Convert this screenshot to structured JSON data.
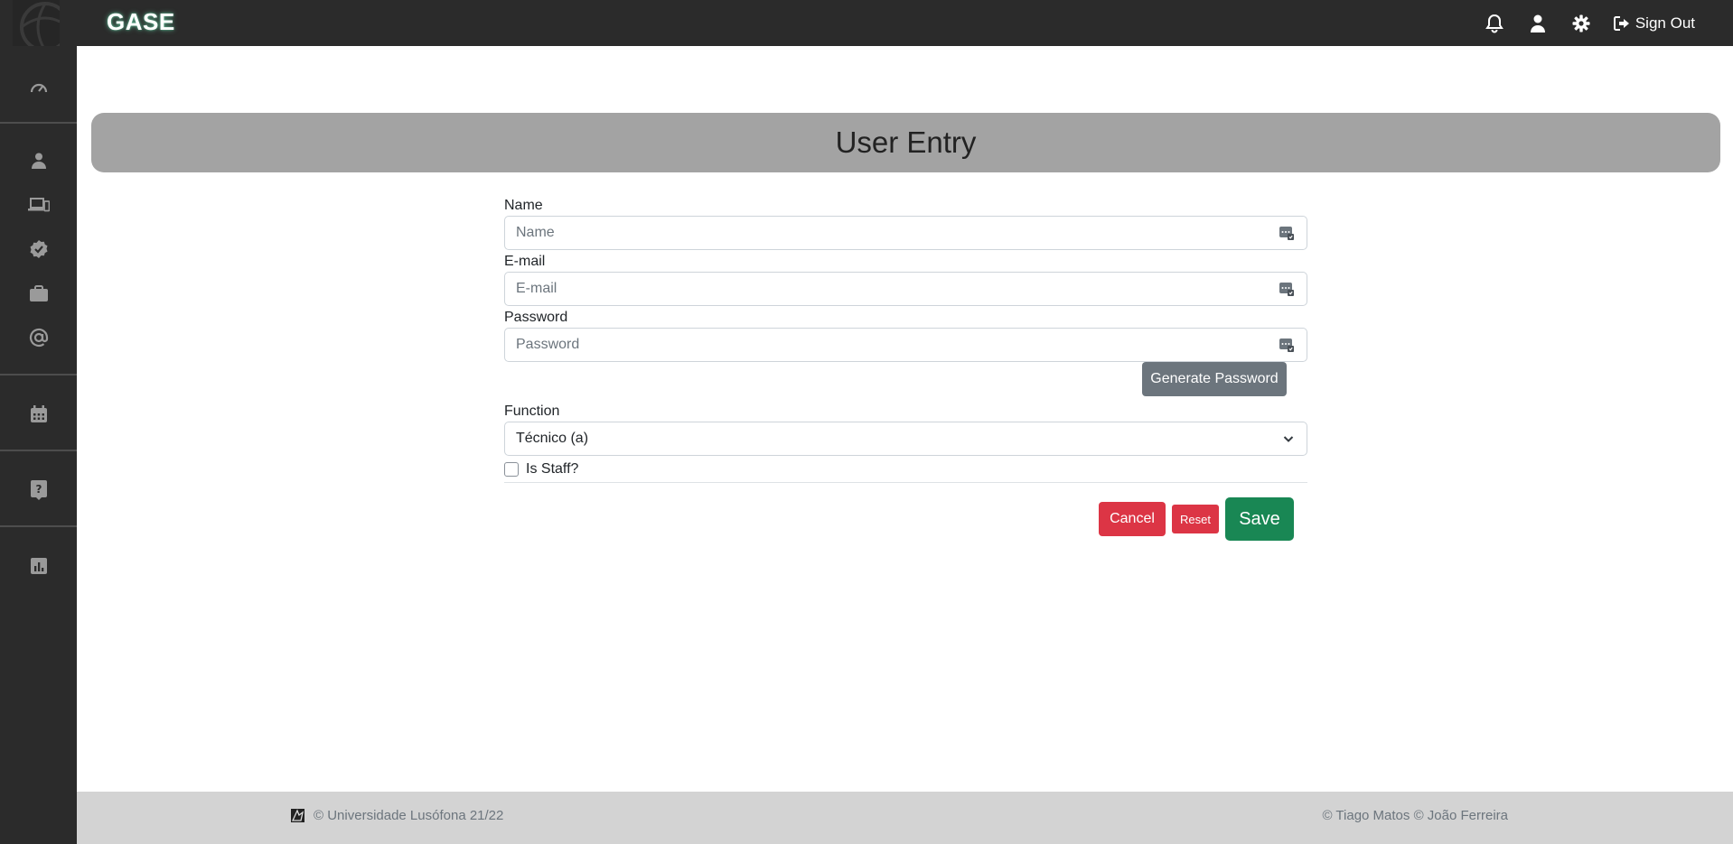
{
  "app": {
    "brand": "GASE"
  },
  "topbar": {
    "signout_label": "Sign Out"
  },
  "page": {
    "title": "User Entry"
  },
  "form": {
    "name": {
      "label": "Name",
      "placeholder": "Name",
      "value": ""
    },
    "email": {
      "label": "E-mail",
      "placeholder": "E-mail",
      "value": ""
    },
    "password": {
      "label": "Password",
      "placeholder": "Password",
      "value": ""
    },
    "generate_label": "Generate Password",
    "function": {
      "label": "Function",
      "selected": "Técnico (a)"
    },
    "is_staff": {
      "label": "Is Staff?",
      "checked": false
    },
    "cancel_label": "Cancel",
    "reset_label": "Reset",
    "save_label": "Save"
  },
  "footer": {
    "left": "© Universidade Lusófona 21/22",
    "right": "© Tiago Matos © João Ferreira"
  },
  "sidebar": {
    "items": [
      "dashboard-icon",
      "user-icon",
      "devices-icon",
      "badge-check-icon",
      "briefcase-icon",
      "at-sign-icon",
      "calendar-icon",
      "help-icon",
      "reports-icon"
    ]
  },
  "colors": {
    "dark": "#2b2b2b",
    "header_band": "#a3a3a3",
    "danger": "#dc3545",
    "success": "#198754",
    "secondary": "#6c757d",
    "footer_bg": "#d3d3d3"
  }
}
